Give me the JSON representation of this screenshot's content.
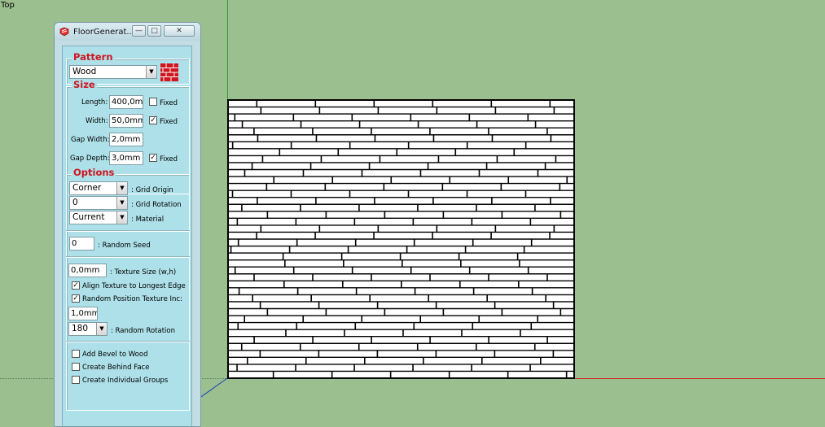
{
  "view": {
    "label": "Top"
  },
  "window": {
    "title": "FloorGenerat...",
    "minimize": "—",
    "maximize": "□",
    "close": "✕",
    "icon": "sketchup-app-icon"
  },
  "pattern": {
    "heading": "Pattern",
    "selected": "Wood",
    "preview_color": "#d0151f"
  },
  "size": {
    "heading": "Size",
    "length_label": "Length:",
    "length_value": "400,0mm",
    "length_fixed": false,
    "width_label": "Width:",
    "width_value": "50,0mm",
    "width_fixed": true,
    "gap_width_label": "Gap Width:",
    "gap_width_value": "2,0mm",
    "gap_depth_label": "Gap Depth:",
    "gap_depth_value": "3,0mm",
    "gap_depth_fixed": true,
    "fixed_label": "Fixed"
  },
  "options": {
    "heading": "Options",
    "grid_origin": "Corner",
    "grid_origin_label": ": Grid Origin",
    "grid_rotation": "0",
    "grid_rotation_label": ": Grid Rotation",
    "material": "Current",
    "material_label": ": Material",
    "random_seed": "0",
    "random_seed_label": ": Random Seed",
    "texture_size": "0,0mm",
    "texture_size_label": ": Texture Size (w,h)",
    "align_texture_label": "Align Texture to Longest Edge",
    "align_texture": true,
    "random_position_label": "Random Position Texture Inc:",
    "random_position": true,
    "random_position_value": "1,0mm",
    "random_rotation": "180",
    "random_rotation_label": ": Random Rotation",
    "add_bevel_label": "Add Bevel to Wood",
    "add_bevel": false,
    "create_behind_label": "Create Behind Face",
    "create_behind": false,
    "create_groups_label": "Create Individual Groups",
    "create_groups": false
  },
  "colors": {
    "background": "#9bbf8e",
    "accent_red": "#d0151f",
    "axis_green": "#2aa02a",
    "axis_red": "#dd2222",
    "axis_blue": "#1a3cc8"
  }
}
